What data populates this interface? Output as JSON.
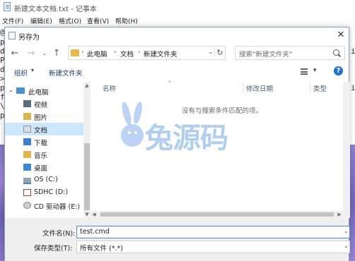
{
  "notepad": {
    "title": "新建文本文档.txt - 记事本",
    "menus": [
      "文件(F)",
      "编辑(E)",
      "格式(O)",
      "查看(V)",
      "帮助(H)"
    ],
    "text_lines": [
      "@",
      "p",
      "d",
      "P",
      "d",
      ">",
      "p",
      "f",
      "\\",
      "p"
    ],
    "right_edge_chars": [
      "i",
      "i"
    ]
  },
  "dialog": {
    "title": "另存为",
    "close_glyph": "✕",
    "address": {
      "segments": [
        "此电脑",
        "文档",
        "新建文件夹"
      ]
    },
    "search": {
      "placeholder": "搜索\"新建文件夹\""
    },
    "toolbar": {
      "organize": "组织",
      "new_folder": "新建文件夹",
      "help": "?"
    },
    "nav_items": [
      {
        "label": "此电脑",
        "icon": "pc-icon",
        "selected": false
      },
      {
        "label": "视频",
        "icon": "video-folder-icon",
        "selected": false
      },
      {
        "label": "图片",
        "icon": "picture-folder-icon",
        "selected": false
      },
      {
        "label": "文档",
        "icon": "document-folder-icon",
        "selected": true
      },
      {
        "label": "下载",
        "icon": "download-folder-icon",
        "selected": false
      },
      {
        "label": "音乐",
        "icon": "music-folder-icon",
        "selected": false
      },
      {
        "label": "桌面",
        "icon": "desktop-folder-icon",
        "selected": false
      },
      {
        "label": "OS (C:)",
        "icon": "os-drive-icon",
        "selected": false
      },
      {
        "label": "SDHC (D:)",
        "icon": "sd-card-icon",
        "selected": false
      },
      {
        "label": "CD 驱动器 (E:)",
        "icon": "cd-drive-icon",
        "selected": false
      }
    ],
    "columns": [
      "名称",
      "修改日期",
      "类型"
    ],
    "empty_message": "没有与搜索条件匹配的项。",
    "watermark": "兔源码",
    "filename_label": "文件名(N):",
    "filename_value": "test.cmd",
    "filetype_label": "保存类型(T):",
    "filetype_value": "所有文件 (*.*)"
  },
  "colors": {
    "accent": "#1e72d4",
    "selected_row": "#cce8ff",
    "folder": "#e8b84a",
    "watermark": "#6ea8e8"
  }
}
